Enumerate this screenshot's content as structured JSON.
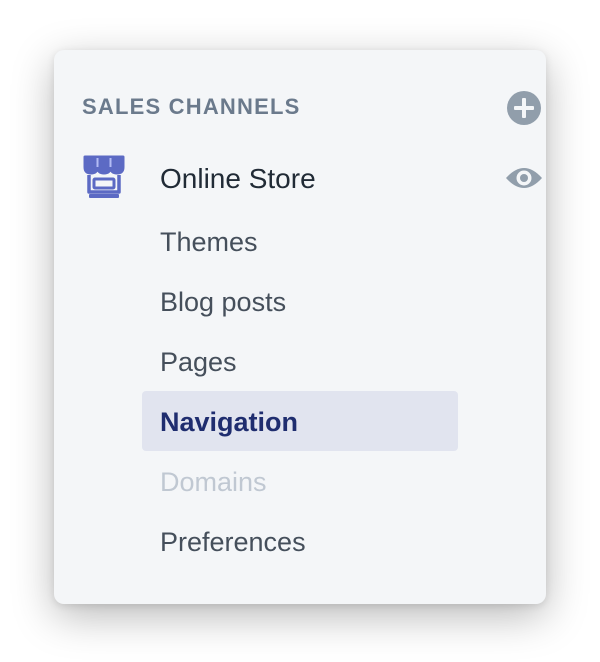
{
  "section": {
    "title": "SALES CHANNELS",
    "add_icon": "plus-circle-icon"
  },
  "channel": {
    "label": "Online Store",
    "icon": "storefront-icon",
    "view_icon": "eye-icon",
    "accent_color": "#5c6ac4"
  },
  "subnav": {
    "items": [
      {
        "label": "Themes",
        "state": "default"
      },
      {
        "label": "Blog posts",
        "state": "default"
      },
      {
        "label": "Pages",
        "state": "default"
      },
      {
        "label": "Navigation",
        "state": "active"
      },
      {
        "label": "Domains",
        "state": "disabled"
      },
      {
        "label": "Preferences",
        "state": "default"
      }
    ]
  },
  "colors": {
    "panel_bg": "#f4f6f8",
    "active_bg": "#e1e4ef",
    "active_text": "#1f2d6f",
    "icon_gray": "#919eab",
    "disabled_text": "#c0c8d2"
  }
}
